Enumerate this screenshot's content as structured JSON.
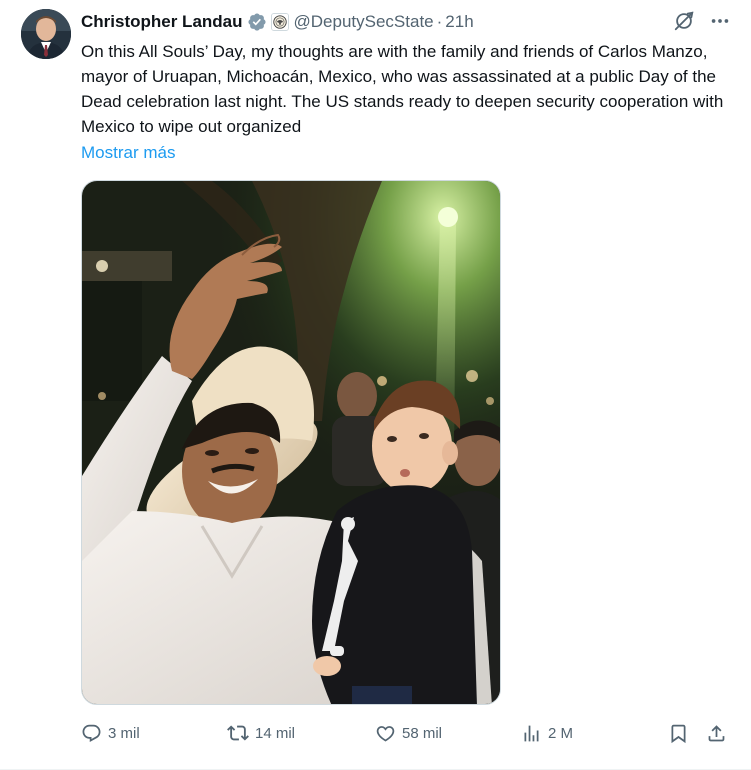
{
  "tweet": {
    "author": {
      "display_name": "Christopher Landau",
      "handle": "@DeputySecState",
      "time": "21h",
      "separator": "·",
      "verified_badge": "gray-check-badge",
      "affiliate_badge": "state-department-seal"
    },
    "text": "On this All Souls’ Day, my thoughts are with the family and friends of Carlos Manzo, mayor of Uruapan, Michoacán, Mexico, who was assassinated at a public Day of the Dead celebration last night. The US stands ready to deepen security cooperation with Mexico to wipe out organized",
    "show_more_label": "Mostrar más",
    "header_icons": [
      "grok-icon",
      "more-icon"
    ],
    "actions": {
      "replies": "3 mil",
      "reposts": "14 mil",
      "likes": "58 mil",
      "views": "2 M"
    },
    "colors": {
      "text": "#0f1419",
      "secondary": "#536471",
      "link": "#1d9bf0",
      "border": "#cfd9de"
    }
  }
}
